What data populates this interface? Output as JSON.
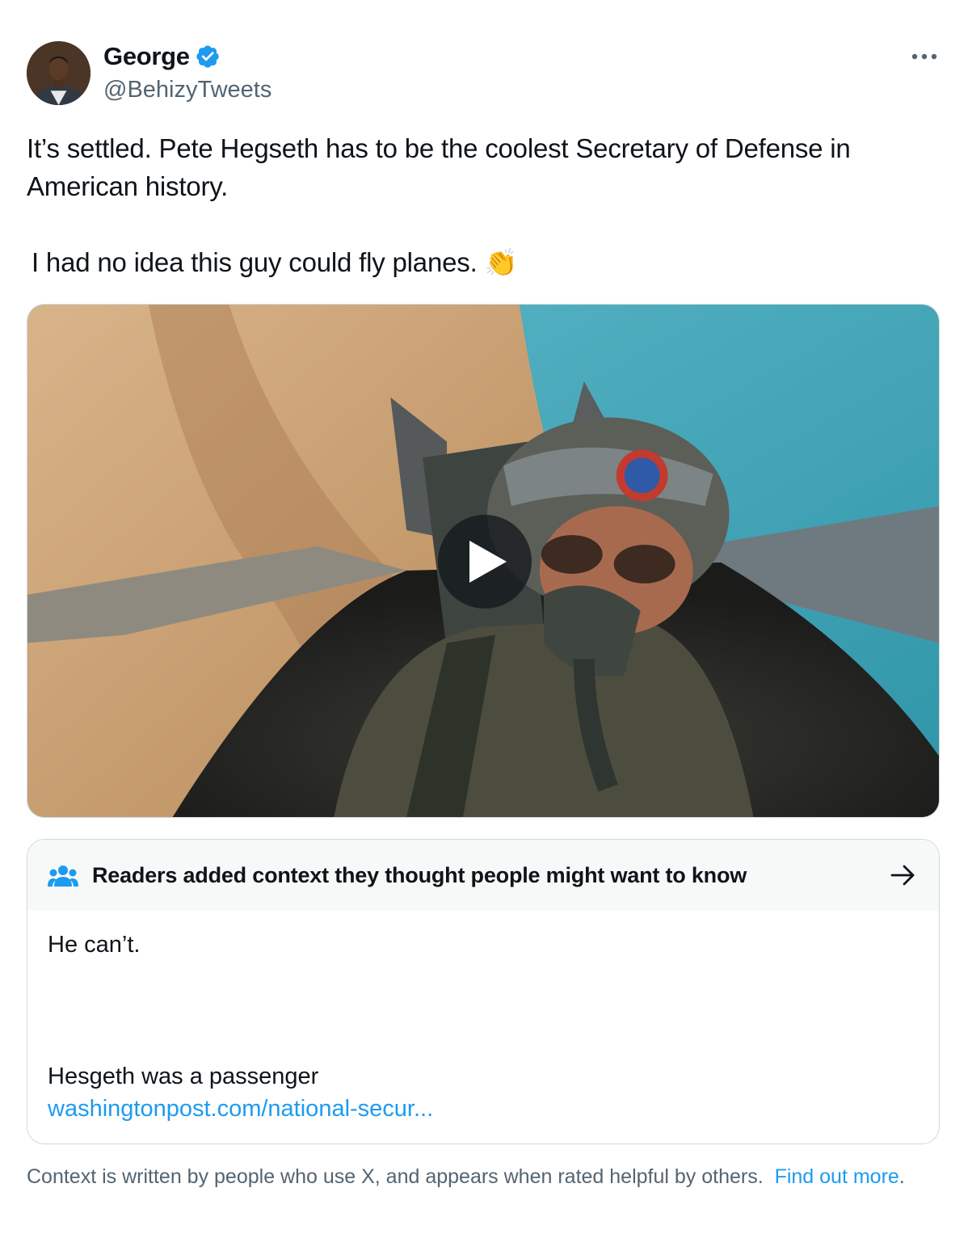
{
  "author": {
    "display_name": "George",
    "handle": "@BehizyTweets",
    "verified": true,
    "verified_color": "#1d9bf0"
  },
  "tweet": {
    "text_line1": "It’s settled. Pete Hegseth has to be the coolest Secretary of Defense in American history.",
    "text_line2": "I had no idea this guy could fly planes. 👏"
  },
  "media": {
    "type": "video",
    "play_icon": "play-icon"
  },
  "community_note": {
    "header": "Readers added context they thought people might want to know",
    "header_icon": "people-icon",
    "arrow_icon": "arrow-right-icon",
    "line1": "He can’t.",
    "line2": "Hesgeth was a passenger",
    "link": "washingtonpost.com/national-secur..."
  },
  "footer": {
    "text": "Context is written by people who use X, and appears when rated helpful by others.",
    "link": "Find out more",
    "period": "."
  },
  "colors": {
    "accent": "#1d9bf0",
    "secondary_text": "#536471",
    "primary_text": "#0f1419",
    "note_header_bg": "#f7f9f9",
    "border": "#cfd9de"
  }
}
